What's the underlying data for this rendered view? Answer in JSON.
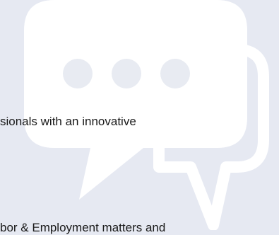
{
  "content": {
    "line_1": "sionals with an innovative",
    "line_2": "bor & Employment matters and"
  },
  "colors": {
    "background": "#e6e9f2",
    "icon_fill": "#ffffff",
    "text": "#1a1a1a"
  },
  "icons": {
    "background": "chat-bubbles-icon"
  }
}
